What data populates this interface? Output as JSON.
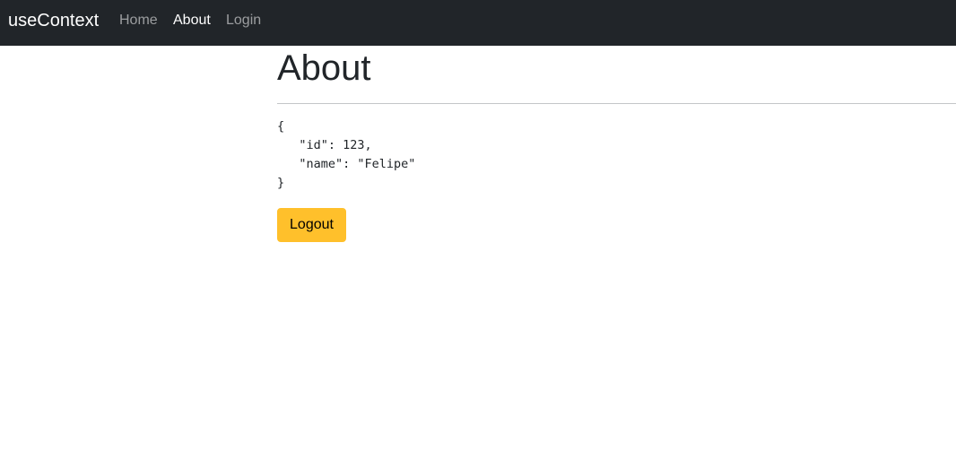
{
  "colors": {
    "navbar_bg": "#212529",
    "nav_active": "#ffffff",
    "nav_inactive": "#8c8e91",
    "button_bg": "#ffc02b",
    "text": "#212529"
  },
  "navbar": {
    "brand": "useContext",
    "links": [
      {
        "label": "Home",
        "active": false
      },
      {
        "label": "About",
        "active": true
      },
      {
        "label": "Login",
        "active": false
      }
    ]
  },
  "main": {
    "title": "About",
    "user_json": "{\n   \"id\": 123,\n   \"name\": \"Felipe\"\n}",
    "logout_label": "Logout"
  }
}
